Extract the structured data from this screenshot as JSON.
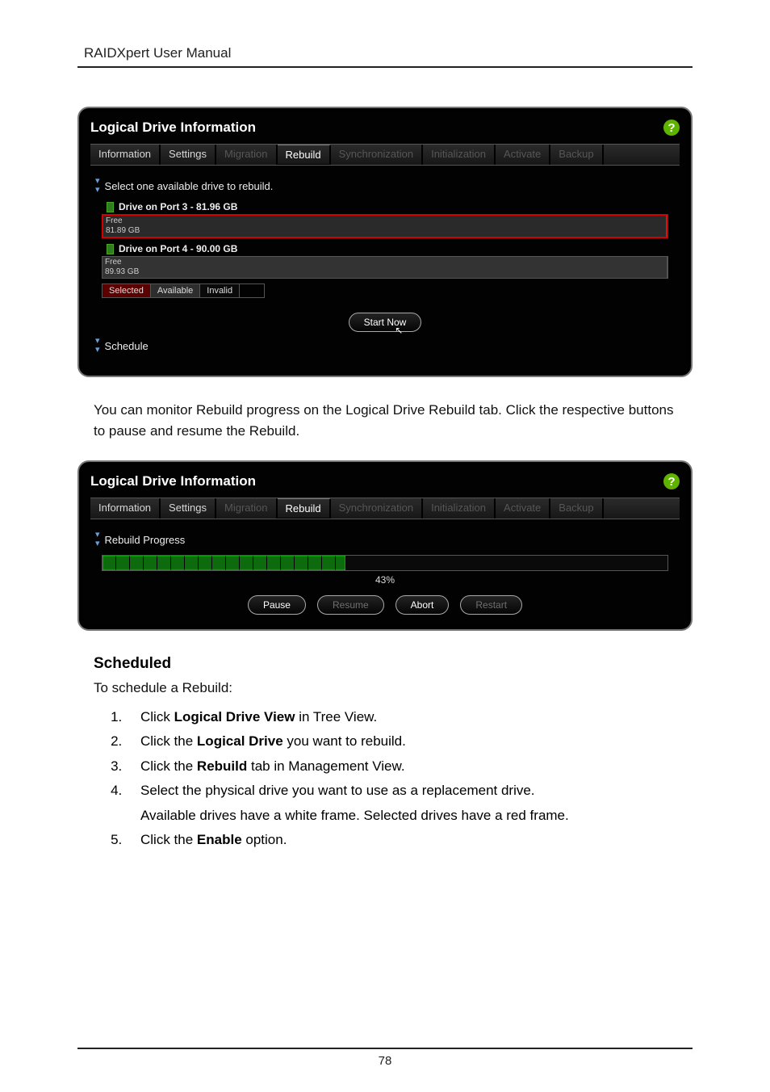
{
  "doc": {
    "running_header": "RAIDXpert User Manual",
    "page_number": "78"
  },
  "panel1": {
    "title": "Logical Drive Information",
    "tabs": {
      "information": "Information",
      "settings": "Settings",
      "migration": "Migration",
      "rebuild": "Rebuild",
      "synchronization": "Synchronization",
      "initialization": "Initialization",
      "activate": "Activate",
      "backup": "Backup"
    },
    "select_prompt": "Select one available drive to rebuild.",
    "drive3": {
      "label": "Drive on Port 3 - 81.96 GB",
      "free_label": "Free",
      "free_size": "81.89 GB"
    },
    "drive4": {
      "label": "Drive on Port 4 - 90.00 GB",
      "free_label": "Free",
      "free_size": "89.93 GB"
    },
    "legend": {
      "selected": "Selected",
      "available": "Available",
      "invalid": "Invalid"
    },
    "start_now": "Start Now",
    "schedule": "Schedule"
  },
  "mid_text": "You can monitor Rebuild progress on the Logical Drive Rebuild tab. Click the respective buttons to pause and resume the Rebuild.",
  "panel2": {
    "title": "Logical Drive Information",
    "tabs": {
      "information": "Information",
      "settings": "Settings",
      "migration": "Migration",
      "rebuild": "Rebuild",
      "synchronization": "Synchronization",
      "initialization": "Initialization",
      "activate": "Activate",
      "backup": "Backup"
    },
    "progress_title": "Rebuild Progress",
    "progress_pct": "43%",
    "buttons": {
      "pause": "Pause",
      "resume": "Resume",
      "abort": "Abort",
      "restart": "Restart"
    }
  },
  "scheduled": {
    "heading": "Scheduled",
    "intro": "To schedule a Rebuild:",
    "step1a": "Click ",
    "step1b": "Logical Drive View",
    "step1c": " in Tree View.",
    "step2a": "Click the ",
    "step2b": "Logical Drive",
    "step2c": " you want to rebuild.",
    "step3a": "Click the ",
    "step3b": "Rebuild",
    "step3c": " tab in Management View.",
    "step4a": "Select the physical drive you want to use as a replacement drive.",
    "step4b": "Available drives have a white frame. Selected drives have a red frame.",
    "step5a": "Click the ",
    "step5b": "Enable",
    "step5c": " option."
  },
  "chart_data": {
    "type": "bar",
    "title": "Rebuild Progress",
    "categories": [
      "Rebuild"
    ],
    "values": [
      43
    ],
    "ylim": [
      0,
      100
    ],
    "ylabel": "%"
  }
}
